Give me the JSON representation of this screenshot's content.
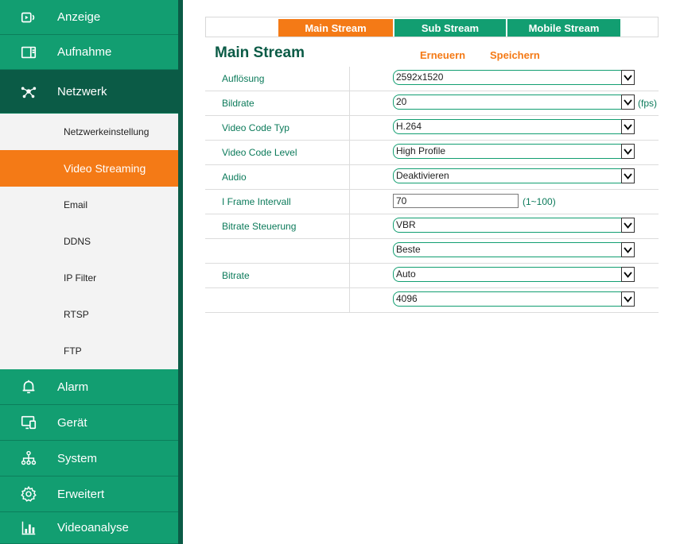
{
  "sidebar": {
    "items": [
      {
        "label": "Anzeige",
        "icon": "play-screen-icon"
      },
      {
        "label": "Aufnahme",
        "icon": "folder-icon"
      },
      {
        "label": "Netzwerk",
        "icon": "network-icon"
      },
      {
        "label": "Alarm",
        "icon": "bell-icon"
      },
      {
        "label": "Gerät",
        "icon": "device-icon"
      },
      {
        "label": "System",
        "icon": "hierarchy-icon"
      },
      {
        "label": "Erweitert",
        "icon": "gear-icon"
      },
      {
        "label": "Videoanalyse",
        "icon": "bar-chart-icon"
      }
    ],
    "sub_items": [
      {
        "label": "Netzwerkeinstellung"
      },
      {
        "label": "Video Streaming"
      },
      {
        "label": "Email"
      },
      {
        "label": "DDNS"
      },
      {
        "label": "IP Filter"
      },
      {
        "label": "RTSP"
      },
      {
        "label": "FTP"
      }
    ]
  },
  "tabs": {
    "main": "Main Stream",
    "sub": "Sub Stream",
    "mobile": "Mobile Stream"
  },
  "header": {
    "title": "Main Stream",
    "refresh": "Erneuern",
    "save": "Speichern"
  },
  "form": {
    "resolution": {
      "label": "Auflösung",
      "value": "2592x1520"
    },
    "framerate": {
      "label": "Bildrate",
      "value": "20",
      "unit": "(fps)"
    },
    "codec_type": {
      "label": "Video Code Typ",
      "value": "H.264"
    },
    "codec_level": {
      "label": "Video Code Level",
      "value": "High Profile"
    },
    "audio": {
      "label": "Audio",
      "value": "Deaktivieren"
    },
    "iframe": {
      "label": "I Frame Intervall",
      "value": "70",
      "range": "(1~100)"
    },
    "bitrate_control": {
      "label": "Bitrate Steuerung",
      "value": "VBR"
    },
    "quality": {
      "value": "Beste"
    },
    "bitrate": {
      "label": "Bitrate",
      "value": "Auto"
    },
    "bitrate_value": {
      "value": "4096"
    }
  },
  "colors": {
    "green": "#129e71",
    "dark_green": "#0b5b46",
    "orange": "#f47a16"
  }
}
